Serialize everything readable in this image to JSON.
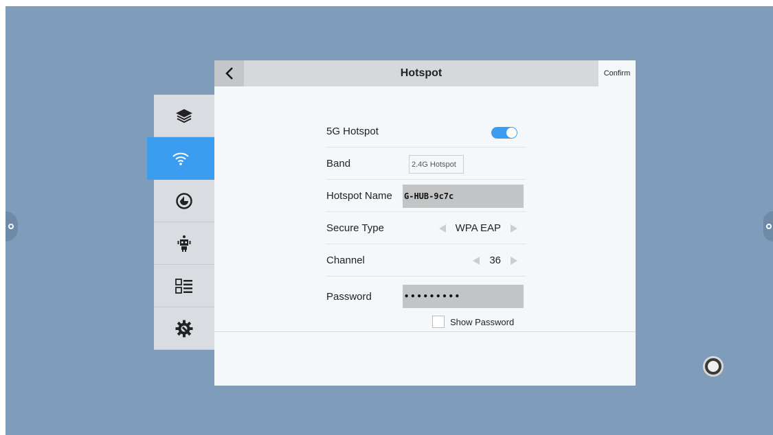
{
  "header": {
    "title": "Hotspot",
    "confirm_label": "Confirm"
  },
  "sidebar": {
    "items": [
      {
        "icon": "layers-icon",
        "active": false
      },
      {
        "icon": "wifi-icon",
        "active": true
      },
      {
        "icon": "clock-icon",
        "active": false
      },
      {
        "icon": "robot-icon",
        "active": false
      },
      {
        "icon": "list-view-icon",
        "active": false
      },
      {
        "icon": "gear-wrench-icon",
        "active": false
      }
    ]
  },
  "form": {
    "hotspot_5g": {
      "label": "5G Hotspot",
      "enabled": true
    },
    "band": {
      "label": "Band",
      "value": "2.4G Hotspot"
    },
    "hotspot_name": {
      "label": "Hotspot Name",
      "value": "G-HUB-9c7c"
    },
    "secure_type": {
      "label": "Secure Type",
      "value": "WPA EAP"
    },
    "channel": {
      "label": "Channel",
      "value": "36"
    },
    "password": {
      "label": "Password",
      "value": "•••••••••"
    },
    "show_password": {
      "label": "Show Password",
      "checked": false
    }
  },
  "colors": {
    "accent": "#3b9df0",
    "desktop": "#7f9dbb",
    "panel": "#f4f8fa"
  }
}
